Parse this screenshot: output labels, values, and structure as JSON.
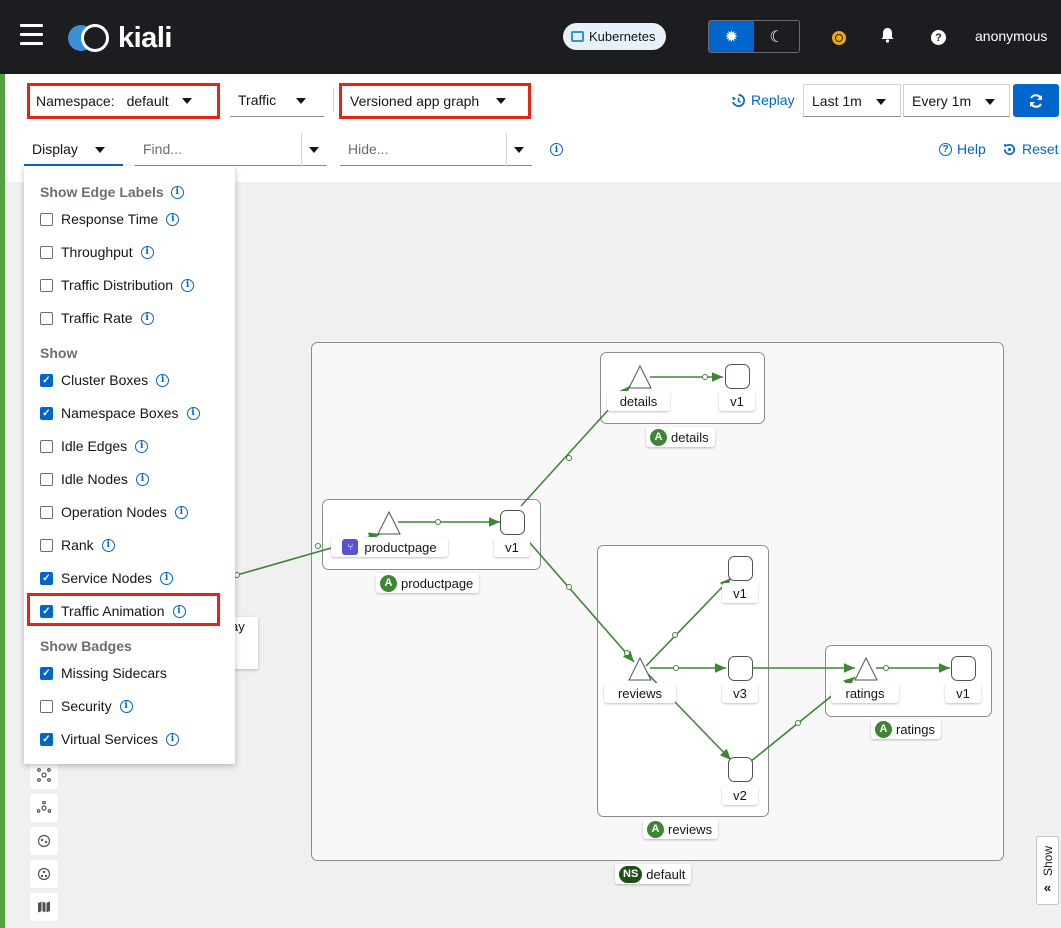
{
  "header": {
    "brand": "kiali",
    "cluster_badge": "Kubernetes",
    "user": "anonymous"
  },
  "toolbar": {
    "namespace_label": "Namespace:",
    "namespace_value": "default",
    "traffic_label": "Traffic",
    "graph_type": "Versioned app graph",
    "replay": "Replay",
    "duration": "Last 1m",
    "refresh_interval": "Every 1m",
    "display_label": "Display",
    "find_placeholder": "Find...",
    "hide_placeholder": "Hide...",
    "help": "Help",
    "reset": "Reset"
  },
  "display_menu": {
    "edge_labels_title": "Show Edge Labels",
    "edge_labels": [
      {
        "label": "Response Time",
        "checked": false
      },
      {
        "label": "Throughput",
        "checked": false
      },
      {
        "label": "Traffic Distribution",
        "checked": false
      },
      {
        "label": "Traffic Rate",
        "checked": false
      }
    ],
    "show_title": "Show",
    "show": [
      {
        "label": "Cluster Boxes",
        "checked": true
      },
      {
        "label": "Namespace Boxes",
        "checked": true
      },
      {
        "label": "Idle Edges",
        "checked": false
      },
      {
        "label": "Idle Nodes",
        "checked": false
      },
      {
        "label": "Operation Nodes",
        "checked": false
      },
      {
        "label": "Rank",
        "checked": false
      },
      {
        "label": "Service Nodes",
        "checked": true
      },
      {
        "label": "Traffic Animation",
        "checked": true
      }
    ],
    "badges_title": "Show Badges",
    "badges": [
      {
        "label": "Missing Sidecars",
        "checked": true
      },
      {
        "label": "Security",
        "checked": false
      },
      {
        "label": "Virtual Services",
        "checked": true
      }
    ]
  },
  "graph": {
    "namespace_badge": "NS",
    "namespace": "default",
    "app_badge": "A",
    "apps": {
      "details": "details",
      "productpage": "productpage",
      "reviews": "reviews",
      "ratings": "ratings"
    },
    "nodes": {
      "details_svc": "details",
      "details_v1": "v1",
      "productpage_svc": "productpage",
      "productpage_v1": "v1",
      "reviews_svc": "reviews",
      "reviews_v1": "v1",
      "reviews_v3": "v3",
      "reviews_v2": "v2",
      "ratings_svc": "ratings",
      "ratings_v1": "v1"
    },
    "legend_partial": "ay"
  },
  "side_tab": "Show",
  "colors": {
    "accent": "#0066cc",
    "edge_green": "#3e8635",
    "highlight_red": "#e0261b",
    "masthead": "#1b1d21"
  }
}
